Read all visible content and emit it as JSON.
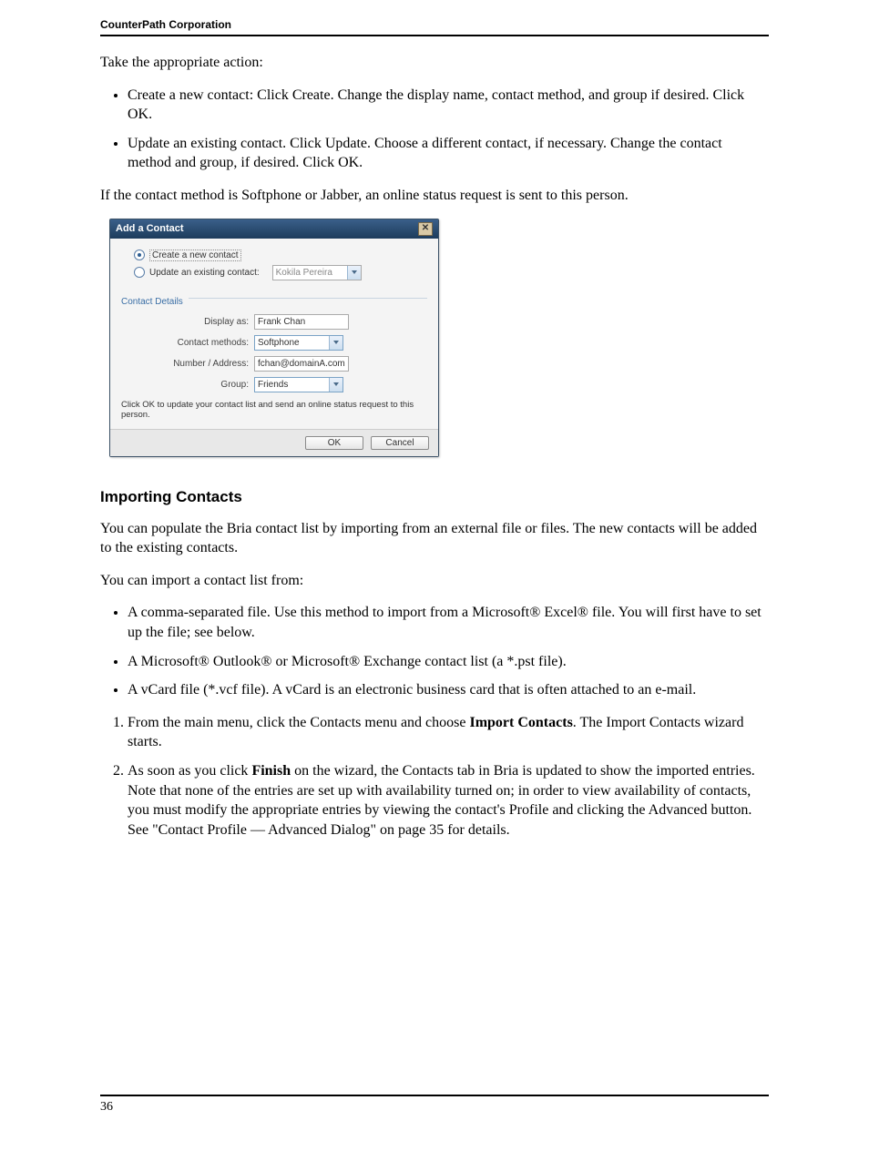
{
  "header": {
    "company": "CounterPath Corporation"
  },
  "intro": "Take the appropriate action:",
  "bullets1": [
    "Create a new contact: Click Create. Change the display name, contact method, and group if desired. Click OK.",
    "Update an existing contact. Click Update. Choose a different contact, if necessary. Change the contact method and group, if desired. Click OK."
  ],
  "after_bullets": "If the contact method is Softphone or Jabber, an online status request is sent to this person.",
  "dialog": {
    "title": "Add a Contact",
    "opt_create": "Create a new contact",
    "opt_update": "Update an existing contact:",
    "existing_contact": "Kokila Pereira",
    "section": "Contact Details",
    "lbl_display": "Display as:",
    "val_display": "Frank Chan",
    "lbl_methods": "Contact methods:",
    "val_methods": "Softphone",
    "lbl_addr": "Number / Address:",
    "val_addr": "fchan@domainA.com",
    "lbl_group": "Group:",
    "val_group": "Friends",
    "hint": "Click OK to update your contact list and send an online status request to this person.",
    "ok": "OK",
    "cancel": "Cancel"
  },
  "section2_title": "Importing Contacts",
  "section2_p1": "You can populate the Bria contact list by importing from an external file or files. The new contacts will be added to the existing contacts.",
  "section2_p2": "You can import a contact list from:",
  "bullets2": [
    "A comma-separated file. Use this method to import from a Microsoft® Excel® file. You will first have to set up the file; see below.",
    "A Microsoft® Outlook® or Microsoft® Exchange contact list (a *.pst file).",
    "A vCard file (*.vcf file). A vCard is an electronic business card that is often attached to an e-mail."
  ],
  "steps": [
    {
      "pre": "From the main menu, click the Contacts menu and choose ",
      "bold": "Import Contacts",
      "post": ". The Import Contacts wizard starts."
    },
    {
      "pre": "As soon as you click ",
      "bold": "Finish",
      "post": " on the wizard, the Contacts tab in Bria is updated to show the imported entries. Note that none of the entries are set up with availability turned on; in order to view availability of contacts, you must modify the appropriate entries by viewing the contact's Profile and clicking the Advanced button. See \"Contact Profile — Advanced Dialog\" on page 35 for details."
    }
  ],
  "page_number": "36"
}
